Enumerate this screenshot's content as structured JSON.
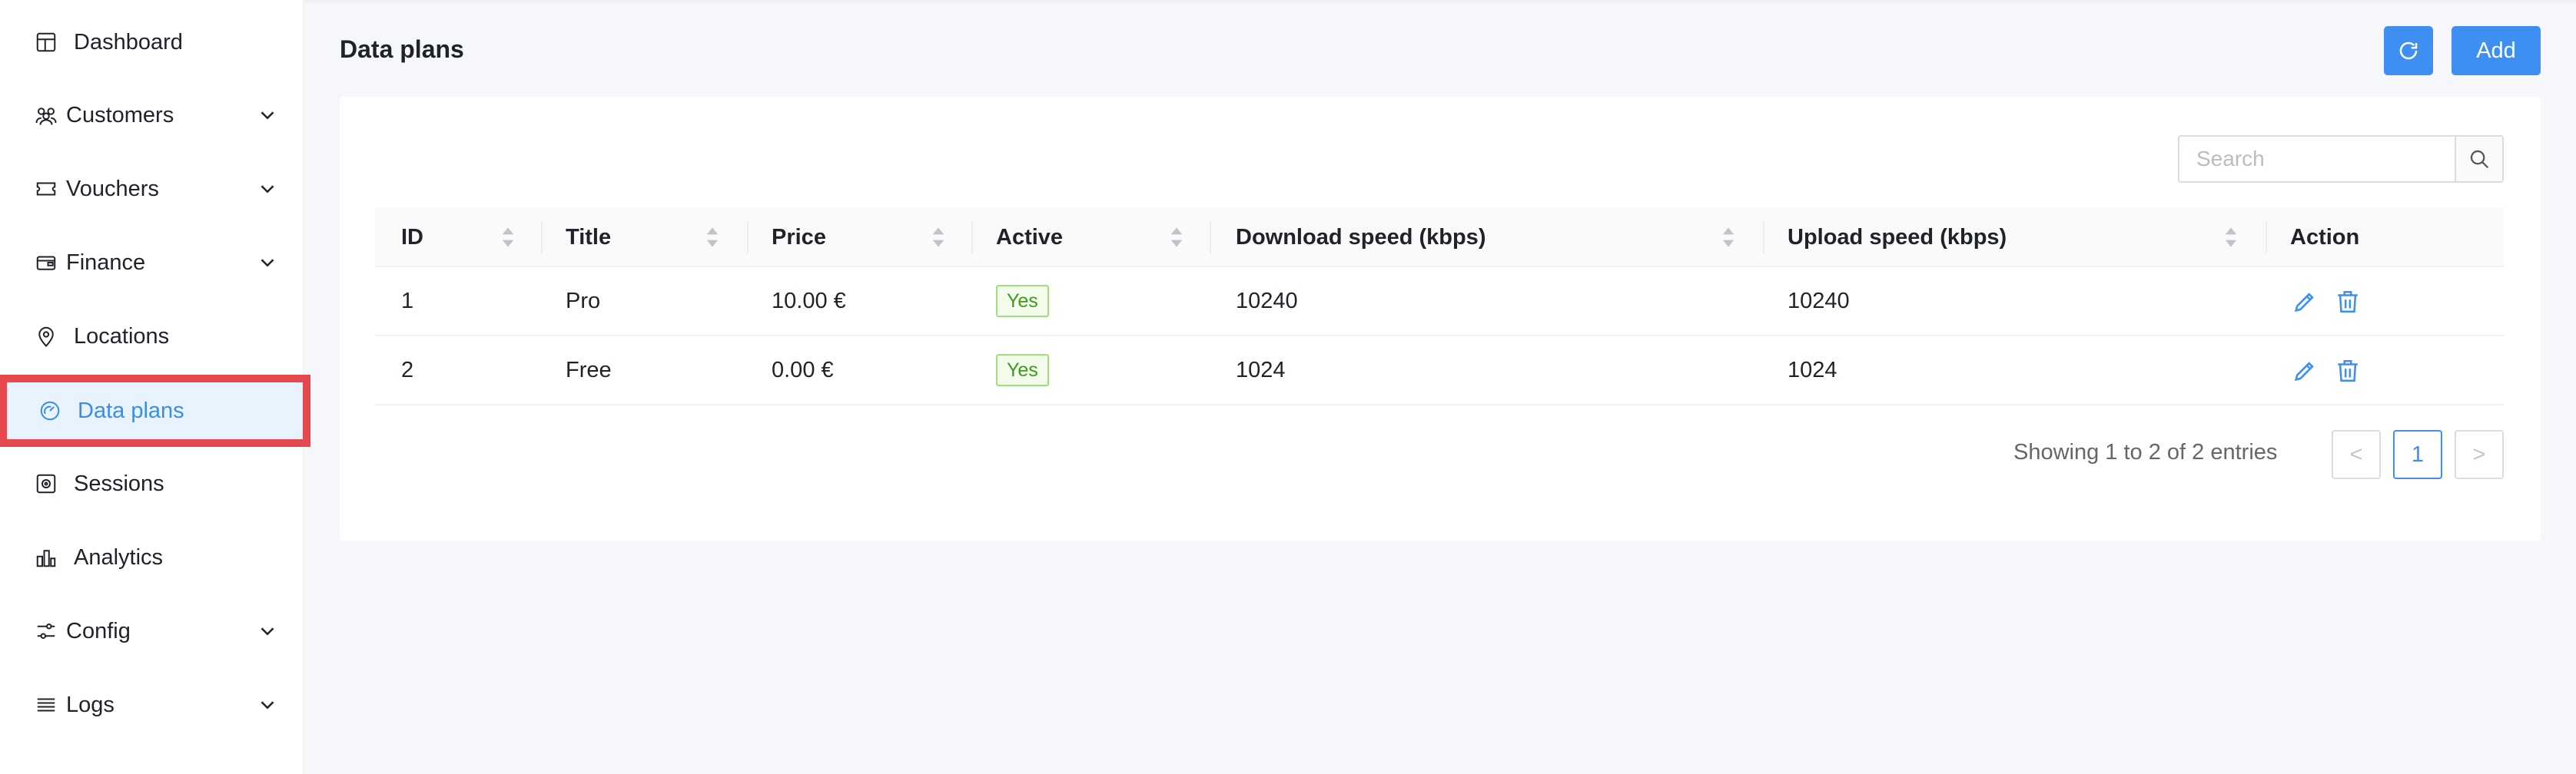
{
  "sidebar": {
    "items": [
      {
        "label": "Dashboard",
        "icon": "layout-icon",
        "has_children": false
      },
      {
        "label": "Customers",
        "icon": "users-icon",
        "has_children": true
      },
      {
        "label": "Vouchers",
        "icon": "ticket-icon",
        "has_children": true
      },
      {
        "label": "Finance",
        "icon": "wallet-icon",
        "has_children": true
      },
      {
        "label": "Locations",
        "icon": "map-pin-icon",
        "has_children": false
      },
      {
        "label": "Data plans",
        "icon": "gauge-icon",
        "has_children": false,
        "active": true
      },
      {
        "label": "Sessions",
        "icon": "session-icon",
        "has_children": false
      },
      {
        "label": "Analytics",
        "icon": "bar-chart-icon",
        "has_children": false
      },
      {
        "label": "Config",
        "icon": "sliders-icon",
        "has_children": true
      },
      {
        "label": "Logs",
        "icon": "list-icon",
        "has_children": true
      }
    ]
  },
  "header": {
    "title": "Data plans",
    "refresh_icon": "refresh-icon",
    "add_label": "Add"
  },
  "search": {
    "placeholder": "Search",
    "icon": "search-icon"
  },
  "table": {
    "columns": [
      "ID",
      "Title",
      "Price",
      "Active",
      "Download speed (kbps)",
      "Upload speed (kbps)",
      "Action"
    ],
    "rows": [
      {
        "id": "1",
        "title": "Pro",
        "price": "10.00 €",
        "active": "Yes",
        "download": "10240",
        "upload": "10240"
      },
      {
        "id": "2",
        "title": "Free",
        "price": "0.00 €",
        "active": "Yes",
        "download": "1024",
        "upload": "1024"
      }
    ]
  },
  "pagination": {
    "showing": "Showing 1 to 2 of 2 entries",
    "prev": "<",
    "current": "1",
    "next": ">"
  },
  "colors": {
    "accent": "#3f8ef2",
    "active_highlight": "#e5484d",
    "tag_green": "#3d9a1c"
  }
}
